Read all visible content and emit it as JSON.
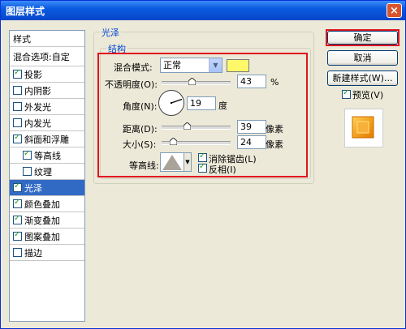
{
  "window": {
    "title": "图层样式",
    "close_glyph": "×"
  },
  "sidebar": {
    "header": "样式",
    "blend_options": "混合选项:自定",
    "items": [
      {
        "label": "投影",
        "checked": true,
        "indent": false,
        "selected": false
      },
      {
        "label": "内阴影",
        "checked": false,
        "indent": false,
        "selected": false
      },
      {
        "label": "外发光",
        "checked": false,
        "indent": false,
        "selected": false
      },
      {
        "label": "内发光",
        "checked": false,
        "indent": false,
        "selected": false
      },
      {
        "label": "斜面和浮雕",
        "checked": true,
        "indent": false,
        "selected": false
      },
      {
        "label": "等高线",
        "checked": true,
        "indent": true,
        "selected": false
      },
      {
        "label": "纹理",
        "checked": false,
        "indent": true,
        "selected": false
      },
      {
        "label": "光泽",
        "checked": true,
        "indent": false,
        "selected": true
      },
      {
        "label": "颜色叠加",
        "checked": true,
        "indent": false,
        "selected": false
      },
      {
        "label": "渐变叠加",
        "checked": true,
        "indent": false,
        "selected": false
      },
      {
        "label": "图案叠加",
        "checked": true,
        "indent": false,
        "selected": false
      },
      {
        "label": "描边",
        "checked": false,
        "indent": false,
        "selected": false
      }
    ]
  },
  "satin": {
    "group_title": "光泽",
    "structure_title": "结构",
    "blend_mode_label": "混合模式:",
    "blend_mode_value": "正常",
    "swatch_color": "#fff86a",
    "opacity_label": "不透明度(O):",
    "opacity_value": "43",
    "opacity_unit": "%",
    "angle_label": "角度(N):",
    "angle_value": "19",
    "angle_unit": "度",
    "distance_label": "距离(D):",
    "distance_value": "39",
    "distance_unit": "像素",
    "size_label": "大小(S):",
    "size_value": "24",
    "size_unit": "像素",
    "contour_label": "等高线:",
    "antialias_label": "消除锯齿(L)",
    "antialias_checked": true,
    "invert_label": "反相(I)",
    "invert_checked": true
  },
  "buttons": {
    "ok": "确定",
    "cancel": "取消",
    "new_style": "新建样式(W)...",
    "preview_label": "预览(V)",
    "preview_checked": true
  },
  "colors": {
    "highlight_red": "#e0141e",
    "selection_blue": "#316ac5"
  }
}
